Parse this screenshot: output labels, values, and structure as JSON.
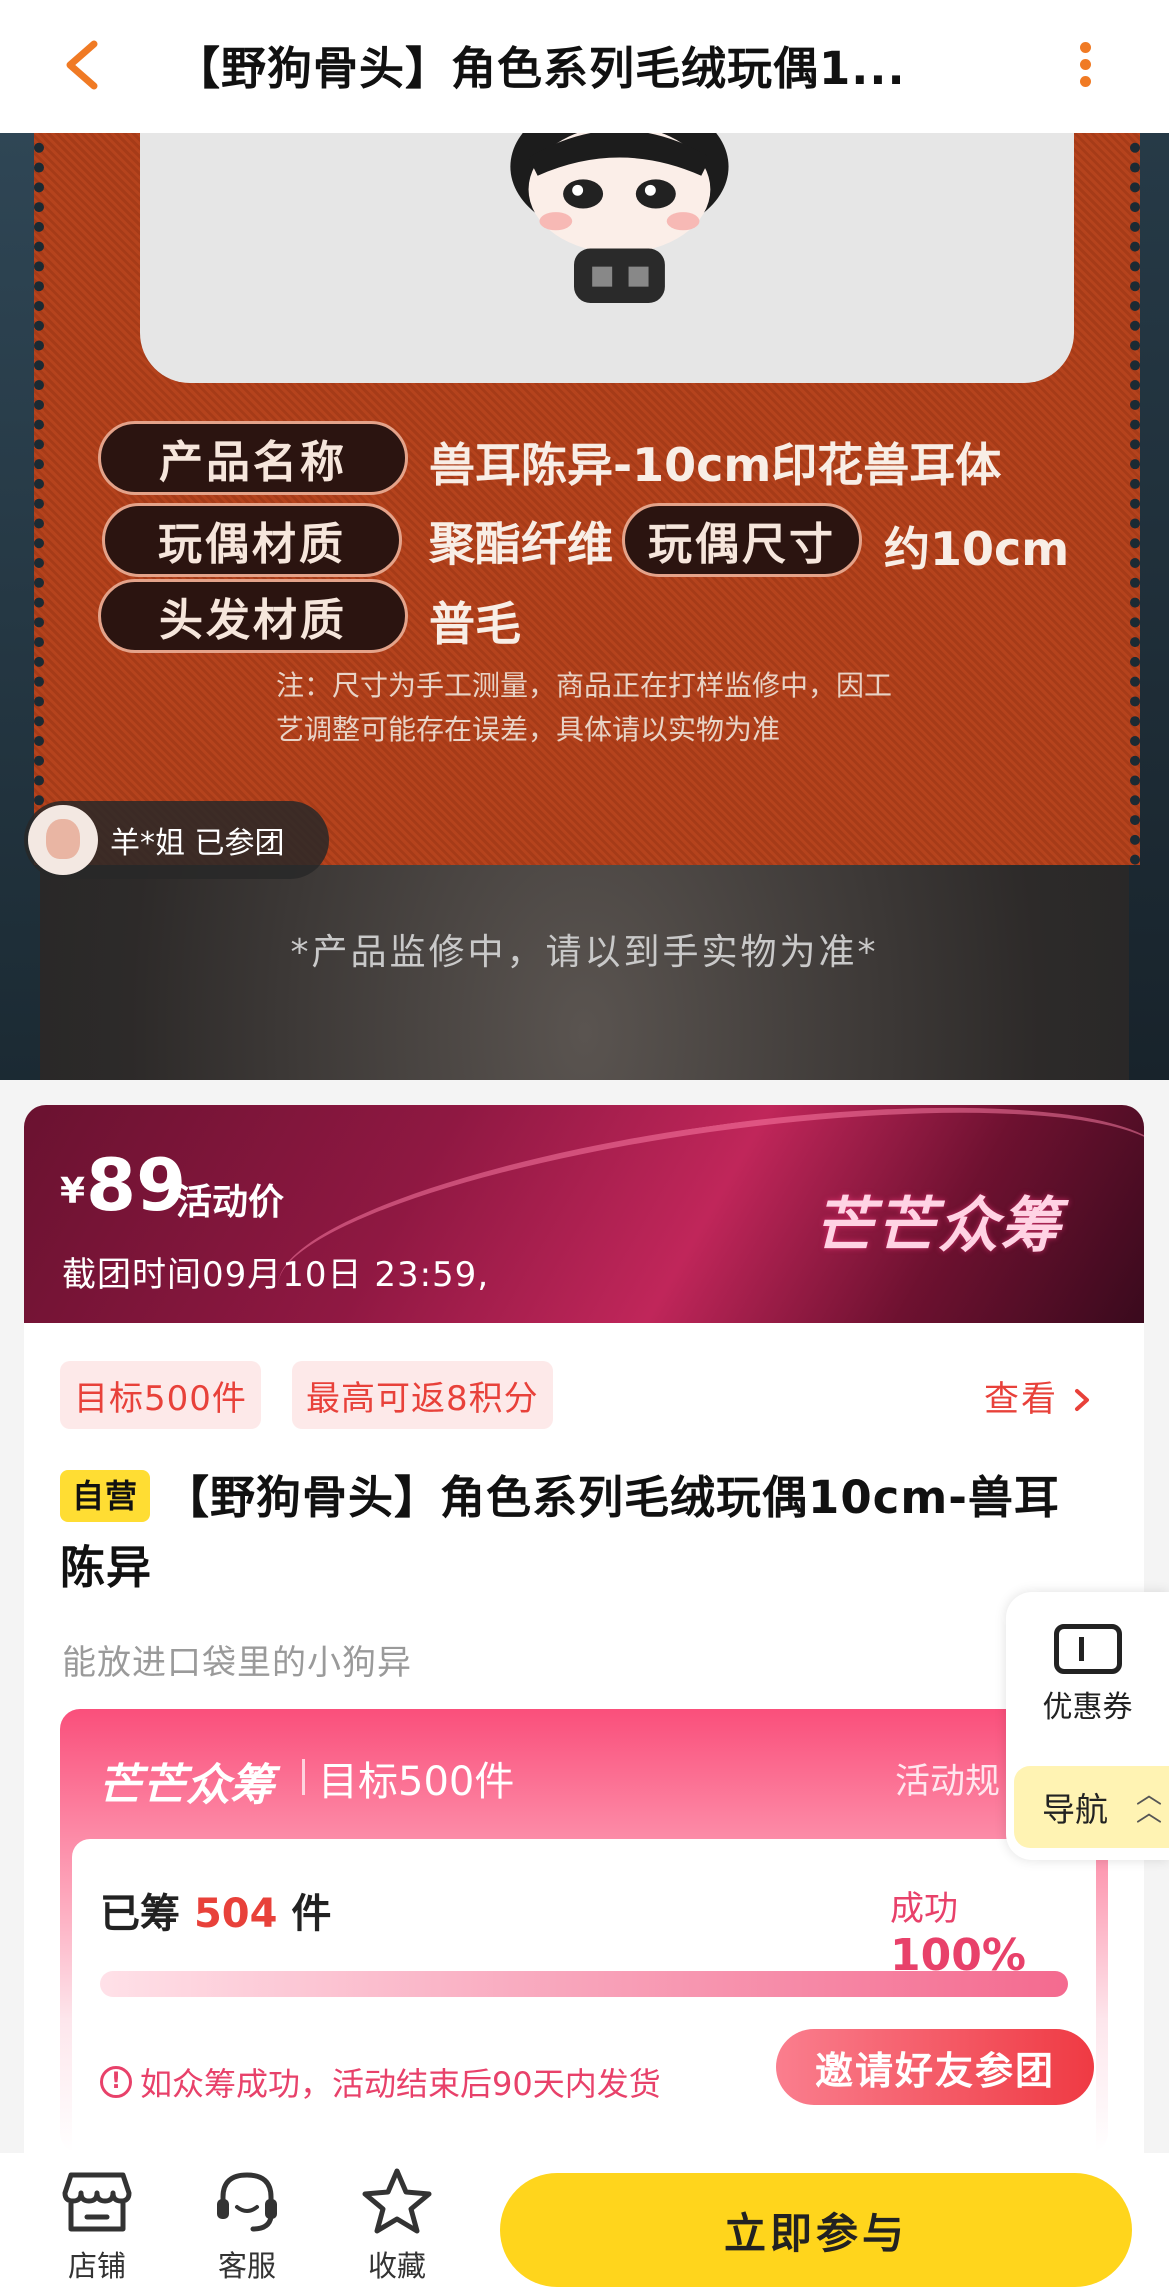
{
  "header": {
    "title": "【野狗骨头】角色系列毛绒玩偶1..."
  },
  "hero": {
    "specs": [
      {
        "label": "产品名称",
        "value": "兽耳陈异-10cm印花兽耳体"
      },
      {
        "label": "玩偶材质",
        "value": "聚酯纤维"
      },
      {
        "label": "玩偶尺寸",
        "value": "约10cm"
      },
      {
        "label": "头发材质",
        "value": "普毛"
      }
    ],
    "note_line1": "注：尺寸为手工测量，商品正在打样监修中，因工",
    "note_line2": "艺调整可能存在误差，具体请以实物为准",
    "caption": "*产品监修中，请以到手实物为准*",
    "participant": "羊*姐 已参团"
  },
  "price_banner": {
    "currency": "¥",
    "price": "89",
    "price_label": "活动价",
    "deadline": "截团时间09月10日 23:59,",
    "brand": "芒芒众筹"
  },
  "product": {
    "tags": [
      "目标500件",
      "最高可返8积分"
    ],
    "view_label": "查看",
    "self_badge": "自营",
    "name": "【野狗骨头】角色系列毛绒玩偶10cm-兽耳陈异",
    "subtitle": "能放进口袋里的小狗异"
  },
  "crowdfund": {
    "logo": "芒芒众筹",
    "goal": "目标500件",
    "rules": "活动规",
    "raised_prefix": "已筹",
    "raised_count": "504",
    "raised_suffix": "件",
    "success_label": "成功",
    "success_percent": "100%",
    "progress": 1.0,
    "shipping_note": "如众筹成功，活动结束后90天内发货",
    "invite_label": "邀请好友参团"
  },
  "side_panel": {
    "coupon_label": "优惠券",
    "nav_label": "导航"
  },
  "bottom_bar": {
    "tabs": [
      "店铺",
      "客服",
      "收藏"
    ],
    "cta": "立即参与"
  },
  "colors": {
    "accent": "#f07a24",
    "red": "#e8413a",
    "pink": "#e8416a",
    "cta_yellow": "#ffd51c"
  }
}
